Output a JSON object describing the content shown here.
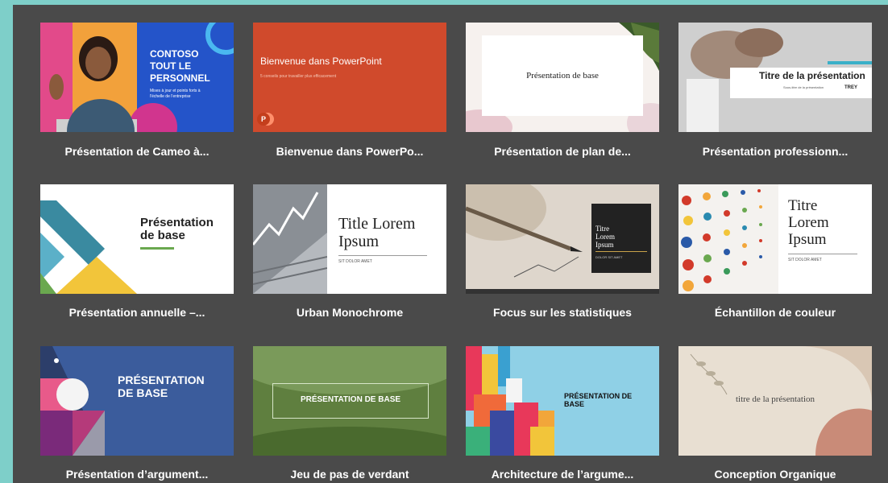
{
  "templates": [
    {
      "caption": "Présentation de Cameo à...",
      "thumb": [
        "CONTOSO",
        "TOUT LE",
        "PERSONNEL",
        "Mises à jour et points forts à l'échelle de l'entreprise"
      ]
    },
    {
      "caption": "Bienvenue dans PowerPo...",
      "thumb": [
        "Bienvenue dans PowerPoint",
        "5 conseils pour travailler plus efficacement"
      ]
    },
    {
      "caption": "Présentation de plan de...",
      "thumb": [
        "Présentation de base"
      ]
    },
    {
      "caption": "Présentation professionn...",
      "thumb": [
        "Titre de la présentation",
        "Sous-titre de la présentation",
        "TREY"
      ]
    },
    {
      "caption": "Présentation annuelle –...",
      "thumb": [
        "Présentation",
        "de base"
      ]
    },
    {
      "caption": "Urban Monochrome",
      "thumb": [
        "Title Lorem",
        "Ipsum",
        "SIT DOLOR AMET"
      ]
    },
    {
      "caption": "Focus sur les statistiques",
      "thumb": [
        "Titre",
        "Lorem",
        "Ipsum",
        "DOLOR SIT AMET"
      ]
    },
    {
      "caption": "Échantillon de couleur",
      "thumb": [
        "Titre",
        "Lorem",
        "Ipsum",
        "SIT DOLOR AMET"
      ]
    },
    {
      "caption": "Présentation d’argument...",
      "thumb": [
        "PRÉSENTATION",
        "DE BASE"
      ]
    },
    {
      "caption": "Jeu de pas de verdant",
      "thumb": [
        "PRÉSENTATION DE BASE"
      ]
    },
    {
      "caption": "Architecture de l’argume...",
      "thumb": [
        "PRÉSENTATION DE",
        "BASE"
      ]
    },
    {
      "caption": "Conception Organique",
      "thumb": [
        "titre de la présentation"
      ]
    }
  ],
  "colors": {
    "background": "#7ecfc9",
    "panel": "#4a4a4a",
    "caption_text": "#ffffff"
  }
}
